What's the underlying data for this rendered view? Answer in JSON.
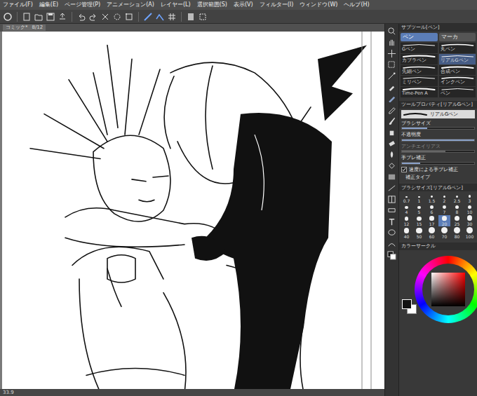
{
  "menu": [
    "ファイル(F)",
    "編集(E)",
    "ページ管理(P)",
    "アニメーション(A)",
    "レイヤー(L)",
    "選択範囲(S)",
    "表示(V)",
    "フィルター(I)",
    "ウィンドウ(W)",
    "ヘルプ(H)"
  ],
  "document_tab": {
    "title": "コミック*",
    "page": "8/12"
  },
  "subtool": {
    "title": "サブツール[ペン]",
    "groups": [
      {
        "label": "ペン",
        "selected": true
      },
      {
        "label": "マーカ",
        "selected": false
      }
    ],
    "brushes": [
      {
        "label": "Gペン",
        "selected": false
      },
      {
        "label": "丸ペン",
        "selected": false
      },
      {
        "label": "カブラペン",
        "selected": false
      },
      {
        "label": "リアルGペン",
        "selected": true
      },
      {
        "label": "先細ペン",
        "selected": false
      },
      {
        "label": "合成ペン",
        "selected": false
      },
      {
        "label": "ミリペン",
        "selected": false
      },
      {
        "label": "インクペン",
        "selected": false
      },
      {
        "label": "Time-Pen A",
        "selected": false
      },
      {
        "label": "ペン",
        "selected": false
      }
    ]
  },
  "tool_property": {
    "title": "ツールプロパティ[リアルGペン]",
    "brush": "リアルGペン",
    "rows": [
      {
        "label": "ブラシサイズ",
        "kind": "slider",
        "level": 0.35,
        "disabled": false
      },
      {
        "label": "不透明度",
        "kind": "slider",
        "level": 1,
        "disabled": false
      },
      {
        "label": "アンチエイリアス",
        "kind": "slider",
        "level": 0.6,
        "disabled": true
      },
      {
        "label": "手ブレ補正",
        "kind": "slider",
        "level": 0.25,
        "disabled": false
      },
      {
        "label": "速度による手ブレ補正",
        "kind": "checkbox",
        "checked": true,
        "disabled": false
      },
      {
        "label": "補正タイプ",
        "kind": "option",
        "disabled": false
      }
    ]
  },
  "brush_size": {
    "title": "ブラシサイズ[リアルGペン]",
    "sizes": [
      {
        "label": "0.7",
        "selected": false
      },
      {
        "label": "1",
        "selected": false
      },
      {
        "label": "1.5",
        "selected": false
      },
      {
        "label": "2",
        "selected": false
      },
      {
        "label": "2.5",
        "selected": false
      },
      {
        "label": "3",
        "selected": false
      },
      {
        "label": "4",
        "selected": false
      },
      {
        "label": "5",
        "selected": false
      },
      {
        "label": "6",
        "selected": false
      },
      {
        "label": "7",
        "selected": false
      },
      {
        "label": "8",
        "selected": false
      },
      {
        "label": "10",
        "selected": false
      },
      {
        "label": "12",
        "selected": false
      },
      {
        "label": "15",
        "selected": false
      },
      {
        "label": "17",
        "selected": false
      },
      {
        "label": "20",
        "selected": true
      },
      {
        "label": "25",
        "selected": false
      },
      {
        "label": "30",
        "selected": false
      },
      {
        "label": "40",
        "selected": false
      },
      {
        "label": "50",
        "selected": false
      },
      {
        "label": "60",
        "selected": false
      },
      {
        "label": "70",
        "selected": false
      },
      {
        "label": "80",
        "selected": false
      },
      {
        "label": "100",
        "selected": false
      }
    ]
  },
  "color": {
    "title": "カラーサークル",
    "swatches": [
      {
        "color": "#111111",
        "selected": true
      },
      {
        "color": "#ffffff",
        "selected": false
      }
    ]
  },
  "status_bar": {
    "zoom": "33.9"
  }
}
